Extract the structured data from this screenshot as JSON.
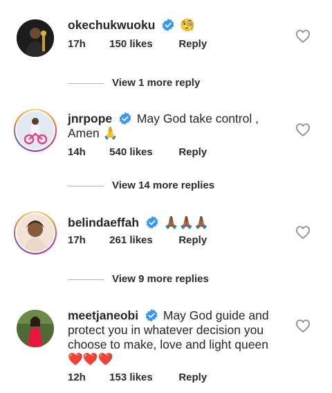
{
  "comments": [
    {
      "username": "okechukwuoku",
      "text": "",
      "emoji": "🧐",
      "time": "17h",
      "likes": "150 likes",
      "reply": "Reply",
      "view_replies": "View 1 more reply",
      "avatar_ring": false,
      "avatar_bg": "#1a1a1a"
    },
    {
      "username": "jnrpope",
      "text": "May God take control , Amen",
      "emoji": "🙏",
      "time": "14h",
      "likes": "540 likes",
      "reply": "Reply",
      "view_replies": "View 14 more replies",
      "avatar_ring": true,
      "avatar_bg": "#dfe6ee"
    },
    {
      "username": "belindaeffah",
      "text": "",
      "emoji": "🙏🏾🙏🏾🙏🏾",
      "time": "17h",
      "likes": "261 likes",
      "reply": "Reply",
      "view_replies": "View 9 more replies",
      "avatar_ring": true,
      "avatar_bg": "#f5e6dc"
    },
    {
      "username": "meetjaneobi",
      "text": "May God guide and protect you in whatever decision you choose to make, love and light queen",
      "emoji": "❤️❤️❤️",
      "time": "12h",
      "likes": "153 likes",
      "reply": "Reply",
      "avatar_ring": false,
      "avatar_bg": "#5a6b3a"
    }
  ],
  "colors": {
    "verified": "#3897f0",
    "text": "#262626",
    "divider": "#b0b0b0",
    "heart": "#8e8e8e"
  },
  "icons": [
    "verified-badge-icon",
    "heart-icon"
  ]
}
